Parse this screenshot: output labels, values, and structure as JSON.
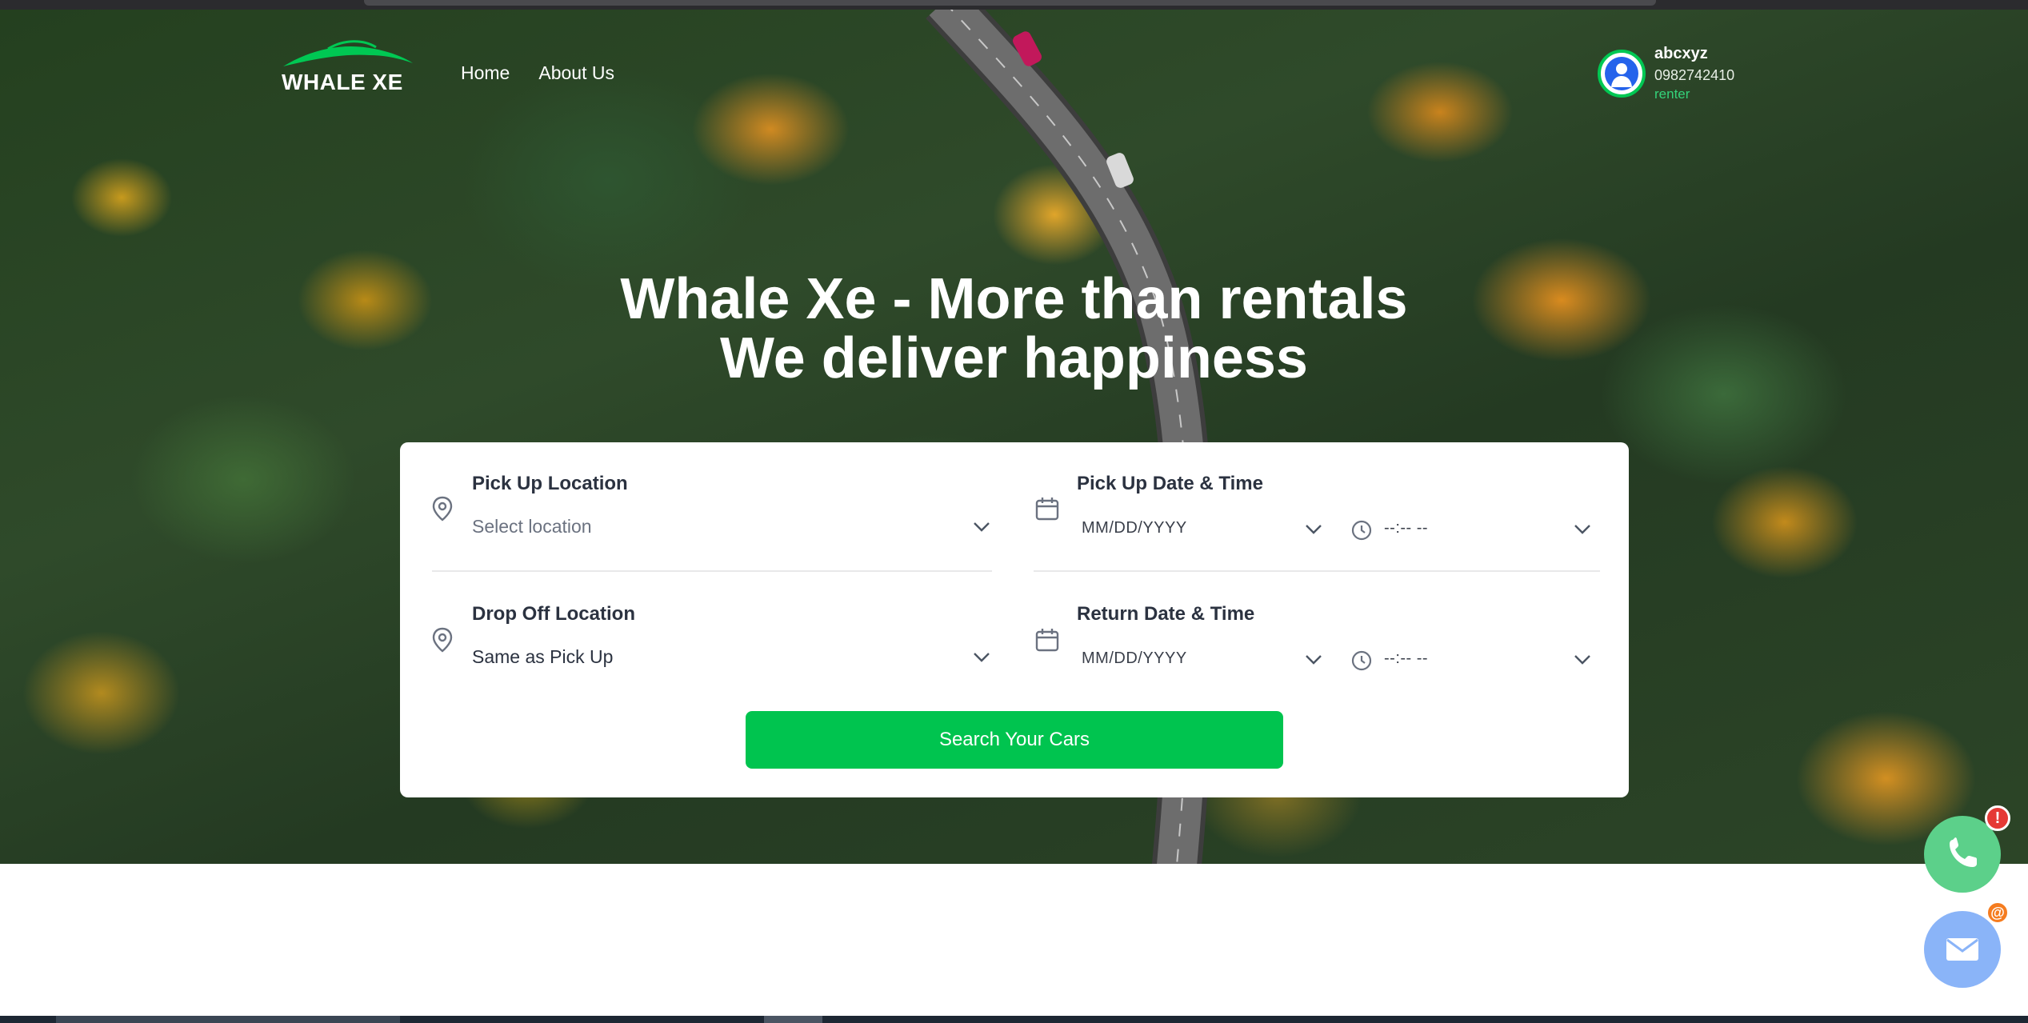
{
  "brand": {
    "name": "WHALE XE",
    "accent": "#00c853"
  },
  "nav": {
    "items": [
      {
        "label": "Home"
      },
      {
        "label": "About Us"
      }
    ]
  },
  "user": {
    "name": "abcxyz",
    "phone": "0982742410",
    "role": "renter",
    "icon": "user-icon"
  },
  "hero": {
    "line1": "Whale Xe - More than rentals",
    "line2": "We deliver happiness"
  },
  "search": {
    "pickup_location": {
      "label": "Pick Up Location",
      "placeholder": "Select location",
      "icon": "location-pin-icon"
    },
    "dropoff_location": {
      "label": "Drop Off Location",
      "value": "Same as Pick Up",
      "icon": "location-pin-icon"
    },
    "pickup_datetime": {
      "label": "Pick Up Date & Time",
      "date_placeholder": "MM/DD/YYYY",
      "time_placeholder": "--:-- --",
      "icon": "calendar-icon"
    },
    "return_datetime": {
      "label": "Return Date & Time",
      "date_placeholder": "MM/DD/YYYY",
      "time_placeholder": "--:-- --",
      "icon": "calendar-icon"
    },
    "submit_label": "Search Your Cars",
    "submit_color": "#00c44f"
  },
  "floating": {
    "phone": {
      "icon": "phone-icon",
      "badge": "!"
    },
    "mail": {
      "icon": "mail-icon",
      "badge": "@"
    }
  }
}
